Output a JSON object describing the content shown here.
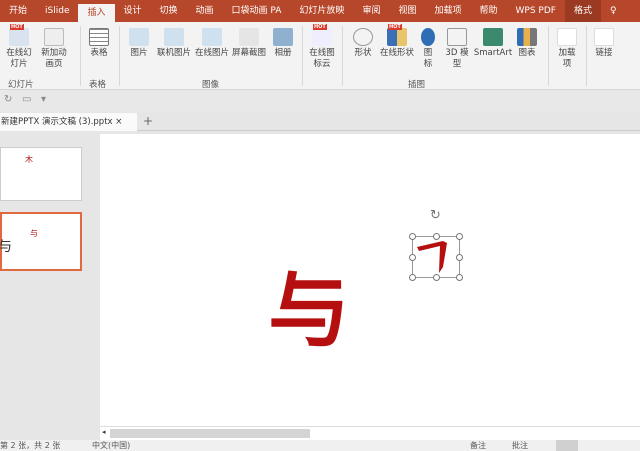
{
  "tabs": [
    "开始",
    "iSlide",
    "插入",
    "设计",
    "切换",
    "动画",
    "口袋动画 PA",
    "幻灯片放映",
    "审阅",
    "视图",
    "加载项",
    "帮助",
    "WPS PDF",
    "格式"
  ],
  "active_tab": "插入",
  "ribbon": {
    "buttons": {
      "online_slides": "在线幻灯片",
      "new_anim_page": "新加动画页",
      "table": "表格",
      "picture": "图片",
      "online_pic": "联机图片",
      "online_pic2": "在线图片",
      "screenshot": "屏幕截图",
      "album": "相册",
      "online_icons": "在线图标云",
      "shapes": "形状",
      "online_shapes": "在线形状",
      "icons": "图标",
      "model3d": "3D 模型",
      "smartart": "SmartArt",
      "chart": "图表",
      "addins": "加载项",
      "link": "链接"
    },
    "groups": {
      "slides": "幻灯片",
      "tables": "表格",
      "images": "图像",
      "illustrations": "插图"
    },
    "hot": "HOT"
  },
  "document_tab": {
    "title": "新建PPTX 演示文稿 (3).pptx",
    "close": "×",
    "add": "+"
  },
  "slides": [
    {
      "char": "木"
    },
    {
      "char": "与"
    }
  ],
  "canvas": {
    "main_char": "与"
  },
  "status": {
    "slide_info": "第 2 张，共 2 张",
    "language": "中文(中国)",
    "notes": "备注",
    "comments": "批注"
  },
  "colors": {
    "accent": "#b7472a",
    "glyph": "#b50f0f"
  }
}
